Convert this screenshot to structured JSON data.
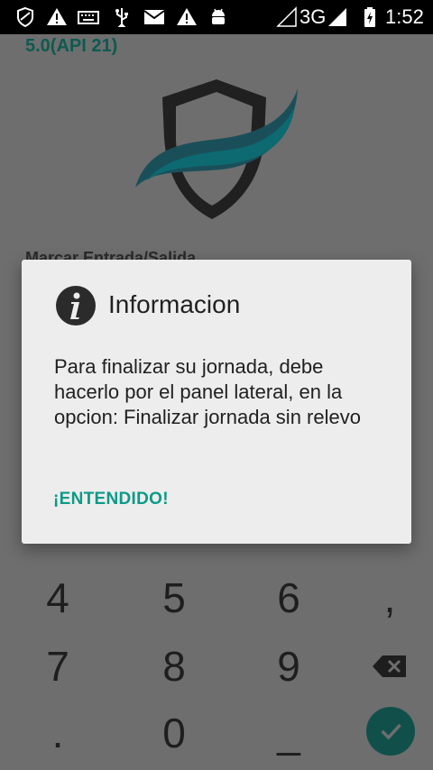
{
  "status_bar": {
    "network": "3G",
    "time": "1:52",
    "icons": [
      "shield-icon",
      "warning-icon",
      "keyboard-icon",
      "usb-icon",
      "mail-icon",
      "warning-icon",
      "android-icon",
      "signal-empty-icon",
      "signal-icon",
      "battery-charging-icon"
    ]
  },
  "app": {
    "version": "5.0(API 21)",
    "section_title": "Marcar Entrada/Salida",
    "keypad": {
      "row1": [
        "4",
        "5",
        "6",
        ","
      ],
      "row2": [
        "7",
        "8",
        "9"
      ],
      "row3": [
        ".",
        "0",
        "_"
      ],
      "delete_icon": "backspace-icon",
      "confirm_icon": "check-icon"
    }
  },
  "dialog": {
    "icon": "info-icon",
    "title": "Informacion",
    "message": "Para finalizar su jornada, debe hacerlo por el panel lateral, en la opcion: Finalizar jornada sin relevo",
    "button": "¡ENTENDIDO!"
  },
  "colors": {
    "accent": "#0b9a86",
    "overlay_bg": "#6e6e6e",
    "dialog_bg": "#ededed",
    "version_text": "#0e5a50",
    "confirm_button": "#11504a"
  }
}
